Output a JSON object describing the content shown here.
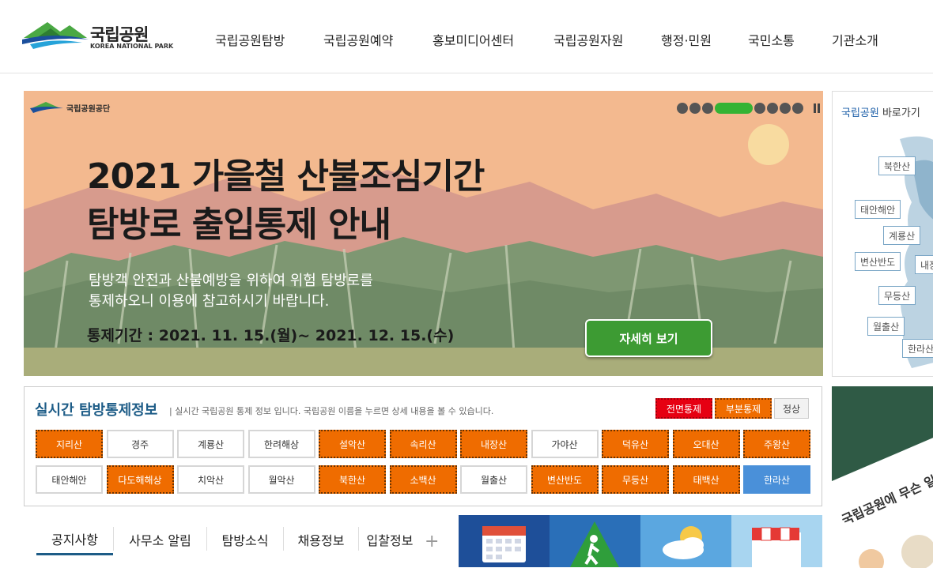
{
  "header": {
    "logo_ko": "국립공원",
    "logo_en": "KOREA NATIONAL PARK",
    "nav": [
      "국립공원탐방",
      "국립공원예약",
      "홍보미디어센터",
      "국립공원자원",
      "행정·민원",
      "국민소통",
      "기관소개"
    ]
  },
  "banner": {
    "org": "국립공원공단",
    "title_line1": "2021 가을철 산불조심기간",
    "title_line2": "탐방로 출입통제 안내",
    "desc_line1": "탐방객 안전과 산불예방을 위하여 위험 탐방로를",
    "desc_line2": "통제하오니 이용에 참고하시기 바랍니다.",
    "period": "통제기간 : 2021. 11. 15.(월)~ 2021. 12. 15.(수)",
    "button": "자세히 보기",
    "slide_count": 8,
    "active_slide": 4,
    "colors": {
      "sky": "#f3b98f",
      "mountain": "#d79b8d",
      "forest": "#6f8a66",
      "button": "#3d9b33"
    }
  },
  "map": {
    "title_strong": "국립공원",
    "title_rest": " 바로가기",
    "tags": [
      "북한산",
      "태안해안",
      "계룡산",
      "변산반도",
      "내장",
      "무등산",
      "월출산",
      "한라산"
    ]
  },
  "status": {
    "title": "실시간 탐방통제정보",
    "subtitle": "| 실시간 국립공원 통제 정보 입니다. 국립공원 이름을 누르면 상세 내용을 볼 수 있습니다.",
    "legend": {
      "full": "전면통제",
      "partial": "부분통제",
      "normal": "정상"
    },
    "parks_row1": [
      {
        "name": "지리산",
        "state": "partial"
      },
      {
        "name": "경주",
        "state": "normal"
      },
      {
        "name": "계룡산",
        "state": "normal"
      },
      {
        "name": "한려해상",
        "state": "normal"
      },
      {
        "name": "설악산",
        "state": "partial"
      },
      {
        "name": "속리산",
        "state": "partial"
      },
      {
        "name": "내장산",
        "state": "partial"
      },
      {
        "name": "가야산",
        "state": "normal"
      },
      {
        "name": "덕유산",
        "state": "partial"
      },
      {
        "name": "오대산",
        "state": "partial"
      },
      {
        "name": "주왕산",
        "state": "partial"
      }
    ],
    "parks_row2": [
      {
        "name": "태안해안",
        "state": "normal"
      },
      {
        "name": "다도해해상",
        "state": "partial"
      },
      {
        "name": "치악산",
        "state": "normal"
      },
      {
        "name": "월악산",
        "state": "normal"
      },
      {
        "name": "북한산",
        "state": "partial"
      },
      {
        "name": "소백산",
        "state": "partial"
      },
      {
        "name": "월출산",
        "state": "normal"
      },
      {
        "name": "변산반도",
        "state": "partial"
      },
      {
        "name": "무등산",
        "state": "partial"
      },
      {
        "name": "태백산",
        "state": "partial"
      },
      {
        "name": "한라산",
        "state": "selected"
      }
    ]
  },
  "tabs": [
    "공지사항",
    "사무소 알림",
    "탐방소식",
    "채용정보",
    "입찰정보"
  ],
  "quick_icons": [
    "calendar-icon",
    "hiker-icon",
    "weather-icon",
    "store-icon"
  ],
  "promo": {
    "text": "국립공원에 무슨 일"
  }
}
